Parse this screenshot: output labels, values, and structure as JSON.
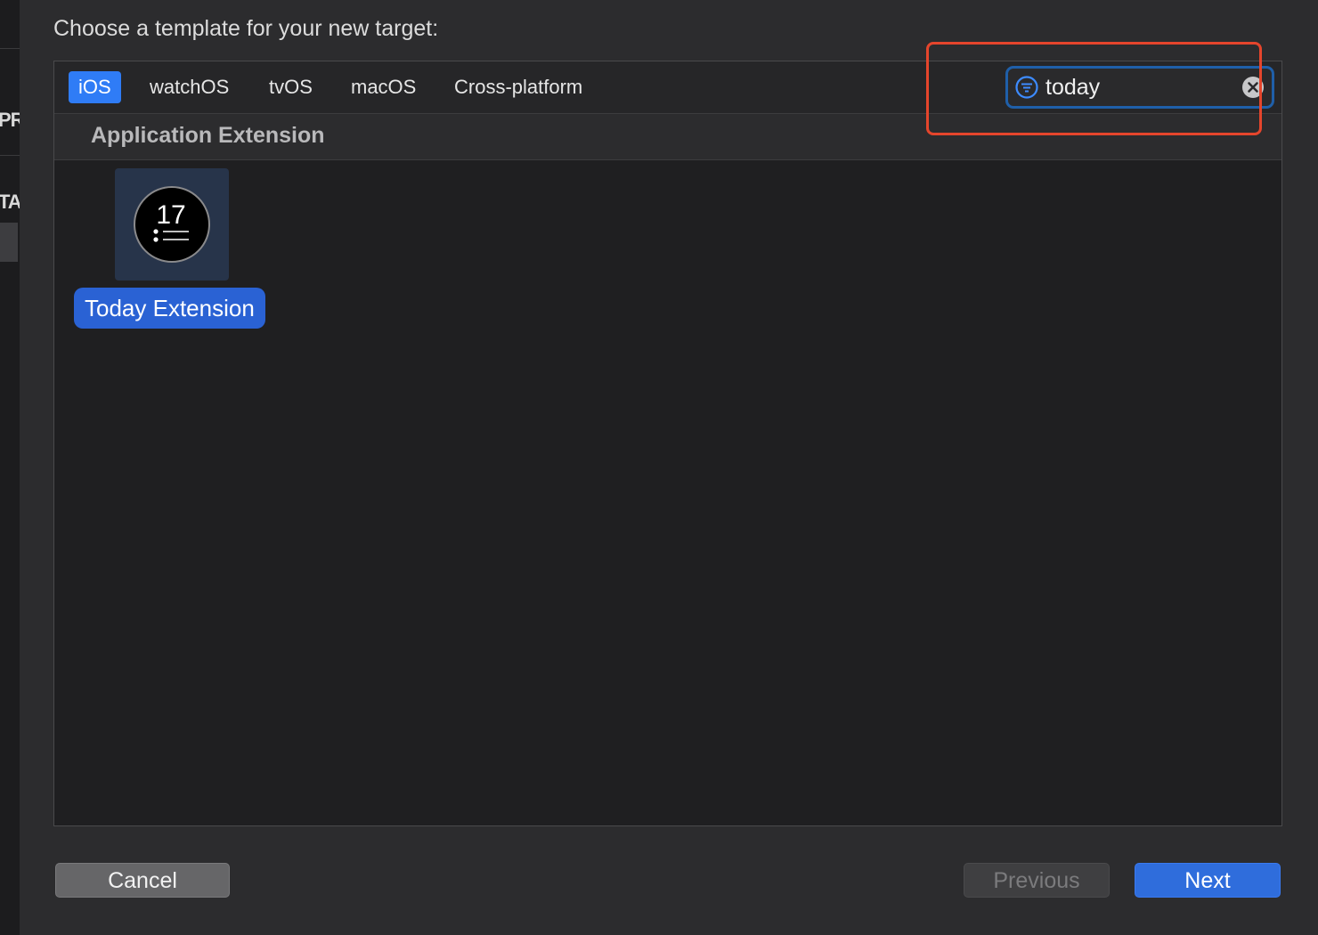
{
  "background": {
    "fragments": [
      "PR",
      "TA"
    ]
  },
  "dialog": {
    "title": "Choose a template for your new target:"
  },
  "platform_tabs": [
    {
      "label": "iOS",
      "selected": true
    },
    {
      "label": "watchOS",
      "selected": false
    },
    {
      "label": "tvOS",
      "selected": false
    },
    {
      "label": "macOS",
      "selected": false
    },
    {
      "label": "Cross-platform",
      "selected": false
    }
  ],
  "search": {
    "value": "today",
    "icon": "filter-icon",
    "clear_icon": "clear-icon"
  },
  "section": {
    "title": "Application Extension"
  },
  "templates": [
    {
      "label": "Today Extension",
      "icon": "today-extension-icon",
      "icon_text": "17",
      "selected": true
    }
  ],
  "buttons": {
    "cancel": "Cancel",
    "previous": "Previous",
    "next": "Next"
  },
  "colors": {
    "accent": "#2f7cf6",
    "selection": "#2a62d4",
    "highlight_annotation": "#e5452c"
  }
}
